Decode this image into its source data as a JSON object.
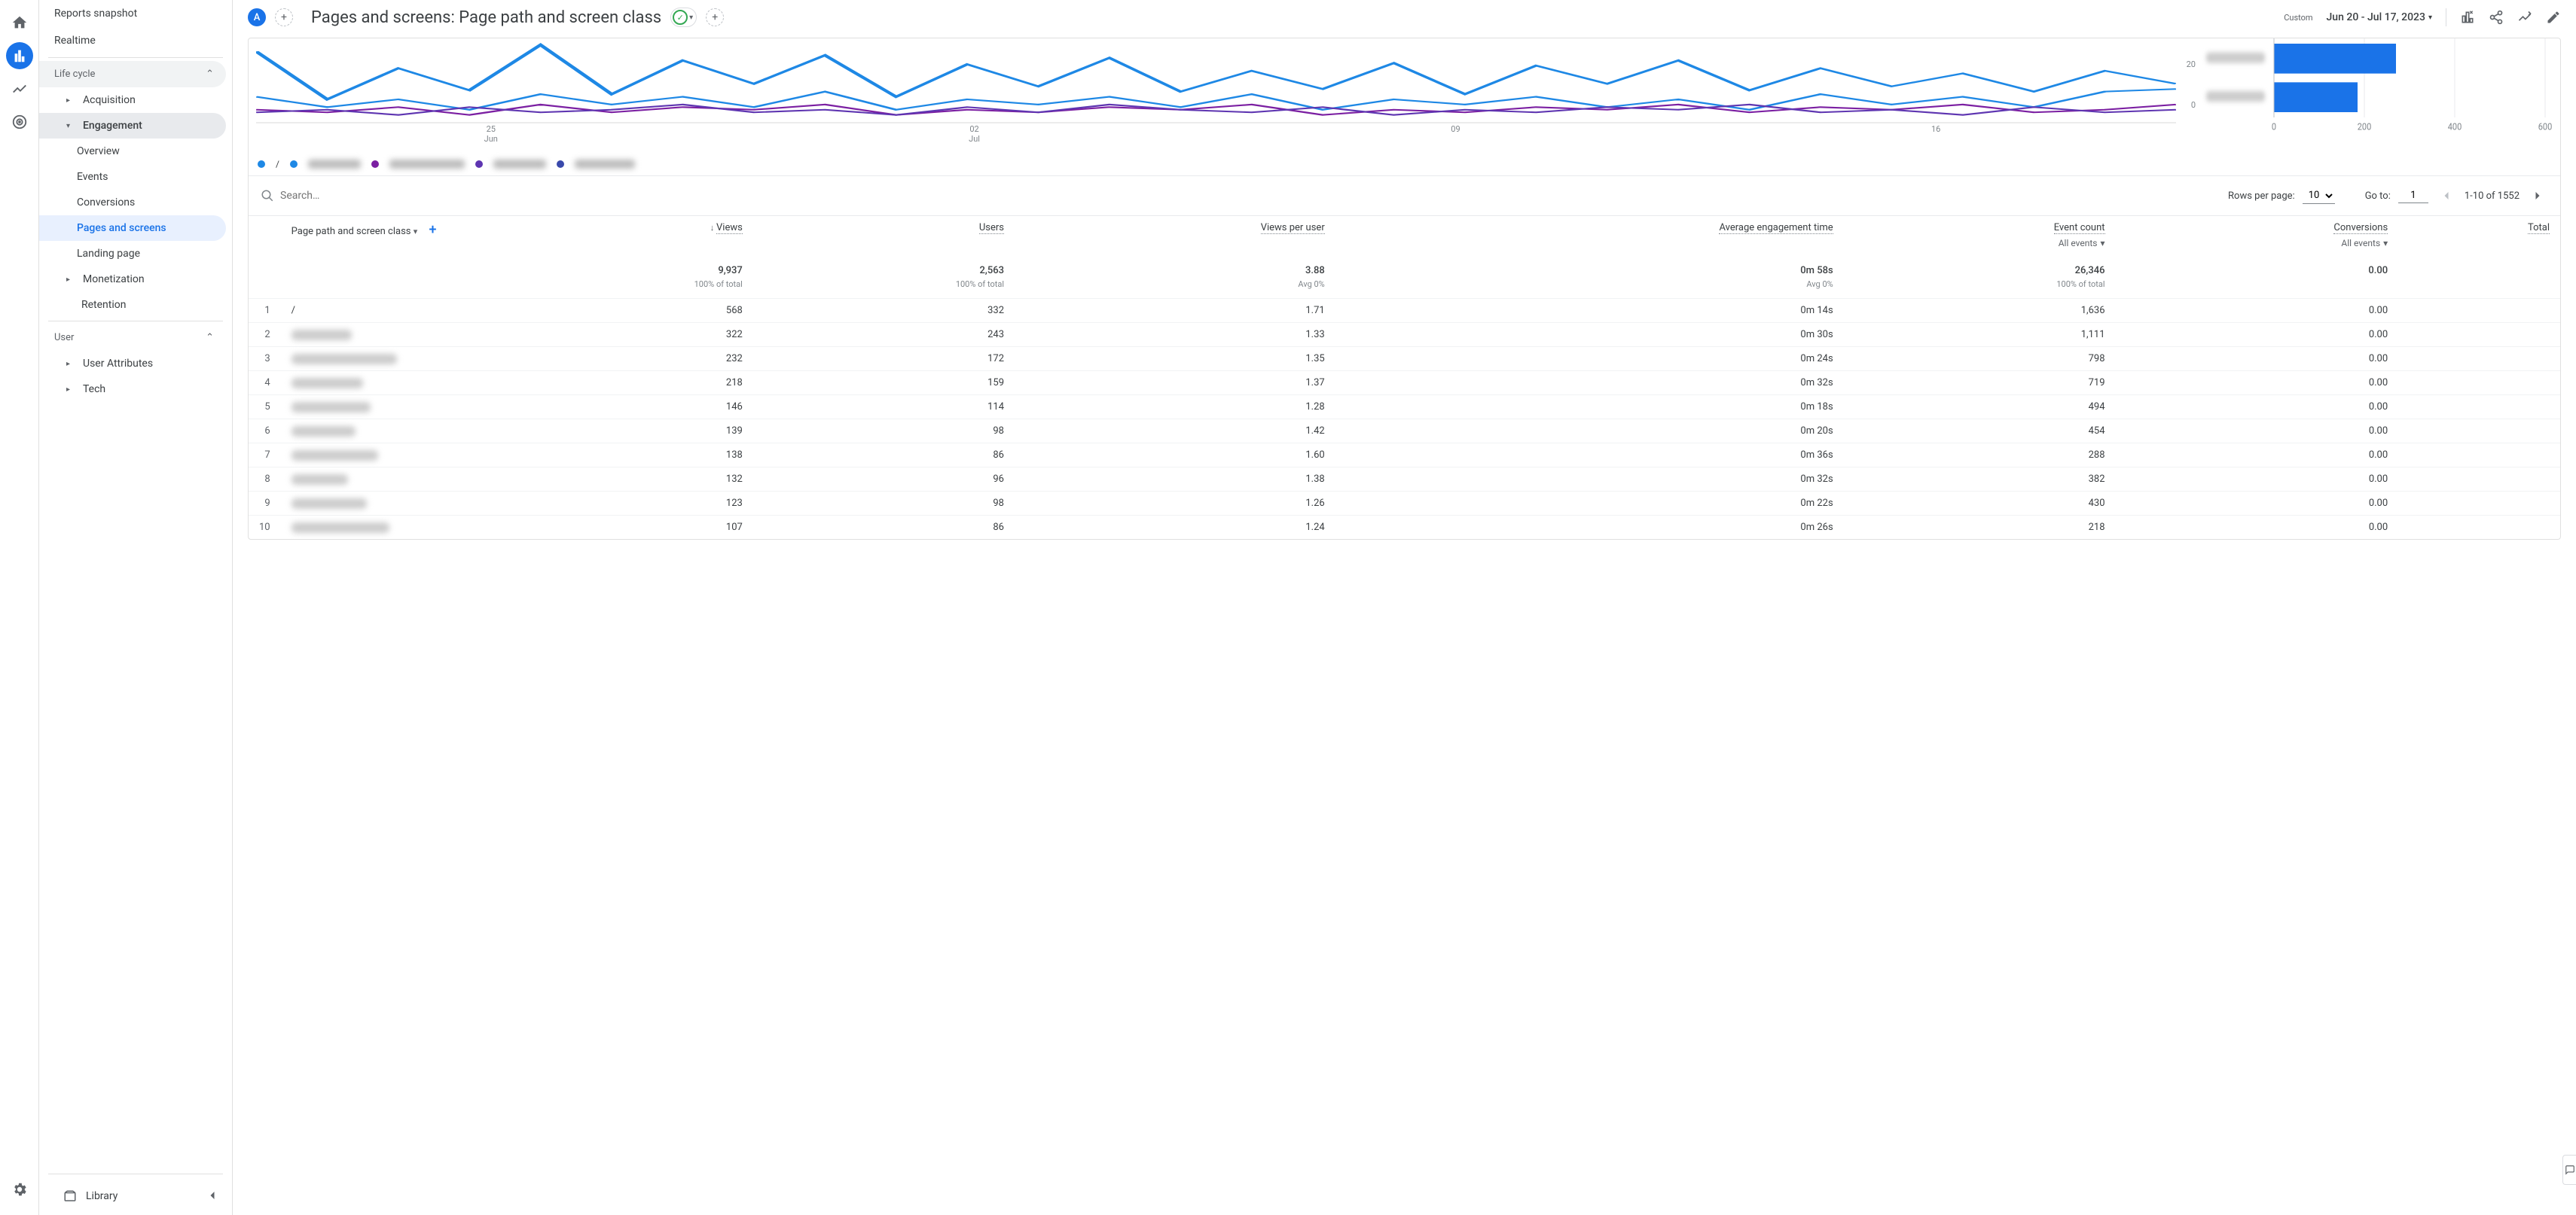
{
  "rail": {
    "avatar_initial": "A"
  },
  "sidebar": {
    "reports_snapshot": "Reports snapshot",
    "realtime": "Realtime",
    "life_cycle": "Life cycle",
    "acquisition": "Acquisition",
    "engagement": "Engagement",
    "engagement_items": {
      "overview": "Overview",
      "events": "Events",
      "conversions": "Conversions",
      "pages_screens": "Pages and screens",
      "landing_page": "Landing page"
    },
    "monetization": "Monetization",
    "retention": "Retention",
    "user": "User",
    "user_attributes": "User Attributes",
    "tech": "Tech",
    "library": "Library"
  },
  "header": {
    "avatar_initial": "A",
    "title": "Pages and screens: Page path and screen class",
    "custom_label": "Custom",
    "date_range": "Jun 20 - Jul 17, 2023"
  },
  "chart_data": {
    "line": {
      "type": "line",
      "x_ticks": [
        {
          "top": "25",
          "bot": "Jun"
        },
        {
          "top": "02",
          "bot": "Jul"
        },
        {
          "top": "09",
          "bot": ""
        },
        {
          "top": "16",
          "bot": ""
        }
      ],
      "y_ticks": [
        "20",
        "0"
      ],
      "series": [
        {
          "name": "/",
          "color": "#1e88e5",
          "values": [
            55,
            18,
            42,
            25,
            60,
            22,
            48,
            30,
            52,
            20,
            45,
            28,
            50,
            24,
            40,
            26,
            46,
            22,
            44,
            30,
            48,
            25,
            42,
            28,
            38,
            24,
            40,
            30
          ]
        },
        {
          "name": "s2",
          "color": "#1e88e5",
          "values": [
            20,
            12,
            18,
            10,
            22,
            14,
            20,
            12,
            24,
            10,
            18,
            14,
            20,
            12,
            22,
            10,
            18,
            14,
            20,
            12,
            18,
            10,
            22,
            14,
            20,
            12,
            24,
            26
          ]
        },
        {
          "name": "s3",
          "color": "#7b1fa2",
          "values": [
            10,
            8,
            12,
            6,
            14,
            8,
            12,
            10,
            14,
            6,
            10,
            8,
            12,
            10,
            14,
            6,
            10,
            8,
            12,
            10,
            14,
            8,
            12,
            10,
            14,
            8,
            10,
            14
          ]
        },
        {
          "name": "s4",
          "color": "#5e35b1",
          "values": [
            8,
            10,
            6,
            12,
            8,
            10,
            14,
            8,
            10,
            6,
            12,
            8,
            14,
            10,
            8,
            12,
            6,
            10,
            8,
            12,
            10,
            14,
            8,
            10,
            6,
            12,
            8,
            10
          ]
        }
      ]
    },
    "bar": {
      "type": "bar",
      "x_ticks": [
        "0",
        "200",
        "400",
        "600"
      ],
      "values": [
        270,
        185
      ],
      "max": 600,
      "color": "#1a73e8"
    }
  },
  "legend": {
    "slash": "/"
  },
  "controls": {
    "search_placeholder": "Search…",
    "rows_per_page_label": "Rows per page:",
    "rows_per_page_value": "10",
    "goto_label": "Go to:",
    "goto_value": "1",
    "page_info": "1-10 of 1552"
  },
  "columns": {
    "dimension": "Page path and screen class",
    "views": "Views",
    "users": "Users",
    "views_per_user": "Views per user",
    "avg_engagement": "Average engagement time",
    "event_count": "Event count",
    "conversions": "Conversions",
    "total": "Total",
    "all_events": "All events"
  },
  "totals": {
    "views": "9,937",
    "users": "2,563",
    "vpu": "3.88",
    "aet": "0m 58s",
    "events": "26,346",
    "conv": "0.00",
    "views_sub": "100% of total",
    "users_sub": "100% of total",
    "vpu_sub": "Avg 0%",
    "aet_sub": "Avg 0%",
    "events_sub": "100% of total"
  },
  "rows": [
    {
      "idx": "1",
      "dim": "/",
      "blur": false,
      "w": 0,
      "views": "568",
      "users": "332",
      "vpu": "1.71",
      "aet": "0m 14s",
      "events": "1,636",
      "conv": "0.00"
    },
    {
      "idx": "2",
      "dim": "",
      "blur": true,
      "w": 80,
      "views": "322",
      "users": "243",
      "vpu": "1.33",
      "aet": "0m 30s",
      "events": "1,111",
      "conv": "0.00"
    },
    {
      "idx": "3",
      "dim": "",
      "blur": true,
      "w": 140,
      "views": "232",
      "users": "172",
      "vpu": "1.35",
      "aet": "0m 24s",
      "events": "798",
      "conv": "0.00"
    },
    {
      "idx": "4",
      "dim": "",
      "blur": true,
      "w": 95,
      "views": "218",
      "users": "159",
      "vpu": "1.37",
      "aet": "0m 32s",
      "events": "719",
      "conv": "0.00"
    },
    {
      "idx": "5",
      "dim": "",
      "blur": true,
      "w": 105,
      "views": "146",
      "users": "114",
      "vpu": "1.28",
      "aet": "0m 18s",
      "events": "494",
      "conv": "0.00"
    },
    {
      "idx": "6",
      "dim": "",
      "blur": true,
      "w": 85,
      "views": "139",
      "users": "98",
      "vpu": "1.42",
      "aet": "0m 20s",
      "events": "454",
      "conv": "0.00"
    },
    {
      "idx": "7",
      "dim": "",
      "blur": true,
      "w": 115,
      "views": "138",
      "users": "86",
      "vpu": "1.60",
      "aet": "0m 36s",
      "events": "288",
      "conv": "0.00"
    },
    {
      "idx": "8",
      "dim": "",
      "blur": true,
      "w": 75,
      "views": "132",
      "users": "96",
      "vpu": "1.38",
      "aet": "0m 32s",
      "events": "382",
      "conv": "0.00"
    },
    {
      "idx": "9",
      "dim": "",
      "blur": true,
      "w": 100,
      "views": "123",
      "users": "98",
      "vpu": "1.26",
      "aet": "0m 22s",
      "events": "430",
      "conv": "0.00"
    },
    {
      "idx": "10",
      "dim": "",
      "blur": true,
      "w": 130,
      "views": "107",
      "users": "86",
      "vpu": "1.24",
      "aet": "0m 26s",
      "events": "218",
      "conv": "0.00"
    }
  ]
}
